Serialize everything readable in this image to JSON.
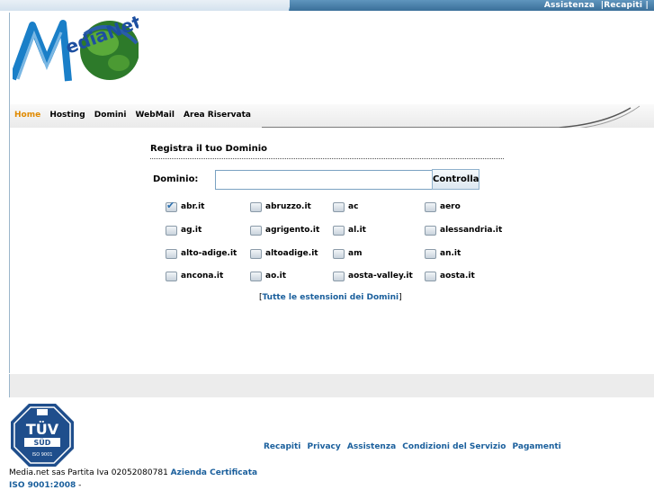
{
  "top_links": {
    "assistenza": "Assistenza",
    "recapiti": "|Recapiti |"
  },
  "nav": {
    "items": [
      "Home",
      "Hosting",
      "Domini",
      "WebMail",
      "Area Riservata"
    ],
    "active_color": "#e08a00"
  },
  "form": {
    "title": "Registra il tuo Dominio",
    "label": "Dominio:",
    "input_value": "",
    "button": "Controlla"
  },
  "extensions": [
    {
      "name": "abr.it",
      "checked": true
    },
    {
      "name": "abruzzo.it",
      "checked": false
    },
    {
      "name": "ac",
      "checked": false
    },
    {
      "name": "aero",
      "checked": false
    },
    {
      "name": "ag.it",
      "checked": false
    },
    {
      "name": "agrigento.it",
      "checked": false
    },
    {
      "name": "al.it",
      "checked": false
    },
    {
      "name": "alessandria.it",
      "checked": false
    },
    {
      "name": "alto-adige.it",
      "checked": false
    },
    {
      "name": "altoadige.it",
      "checked": false
    },
    {
      "name": "am",
      "checked": false
    },
    {
      "name": "an.it",
      "checked": false
    },
    {
      "name": "ancona.it",
      "checked": false
    },
    {
      "name": "ao.it",
      "checked": false
    },
    {
      "name": "aosta-valley.it",
      "checked": false
    },
    {
      "name": "aosta.it",
      "checked": false
    }
  ],
  "all_extensions": {
    "open": "[",
    "link": "Tutte le estensioni dei Domini",
    "close": "]"
  },
  "footer": {
    "links": [
      "Recapiti",
      "Privacy",
      "Assistenza",
      "Condizioni del Servizio",
      "Pagamenti"
    ],
    "company_text": "Media.net sas Partita Iva 02052080781 ",
    "certified_link": "Azienda Certificata",
    "iso_link": "ISO 9001:2008",
    "iso_suffix": " -",
    "tuv_text": "TÜV",
    "tuv_sub": "SÜD",
    "tuv_iso": "ISO 9001"
  },
  "colors": {
    "link": "#1a5f9c",
    "topbar": "#3a6f99"
  }
}
